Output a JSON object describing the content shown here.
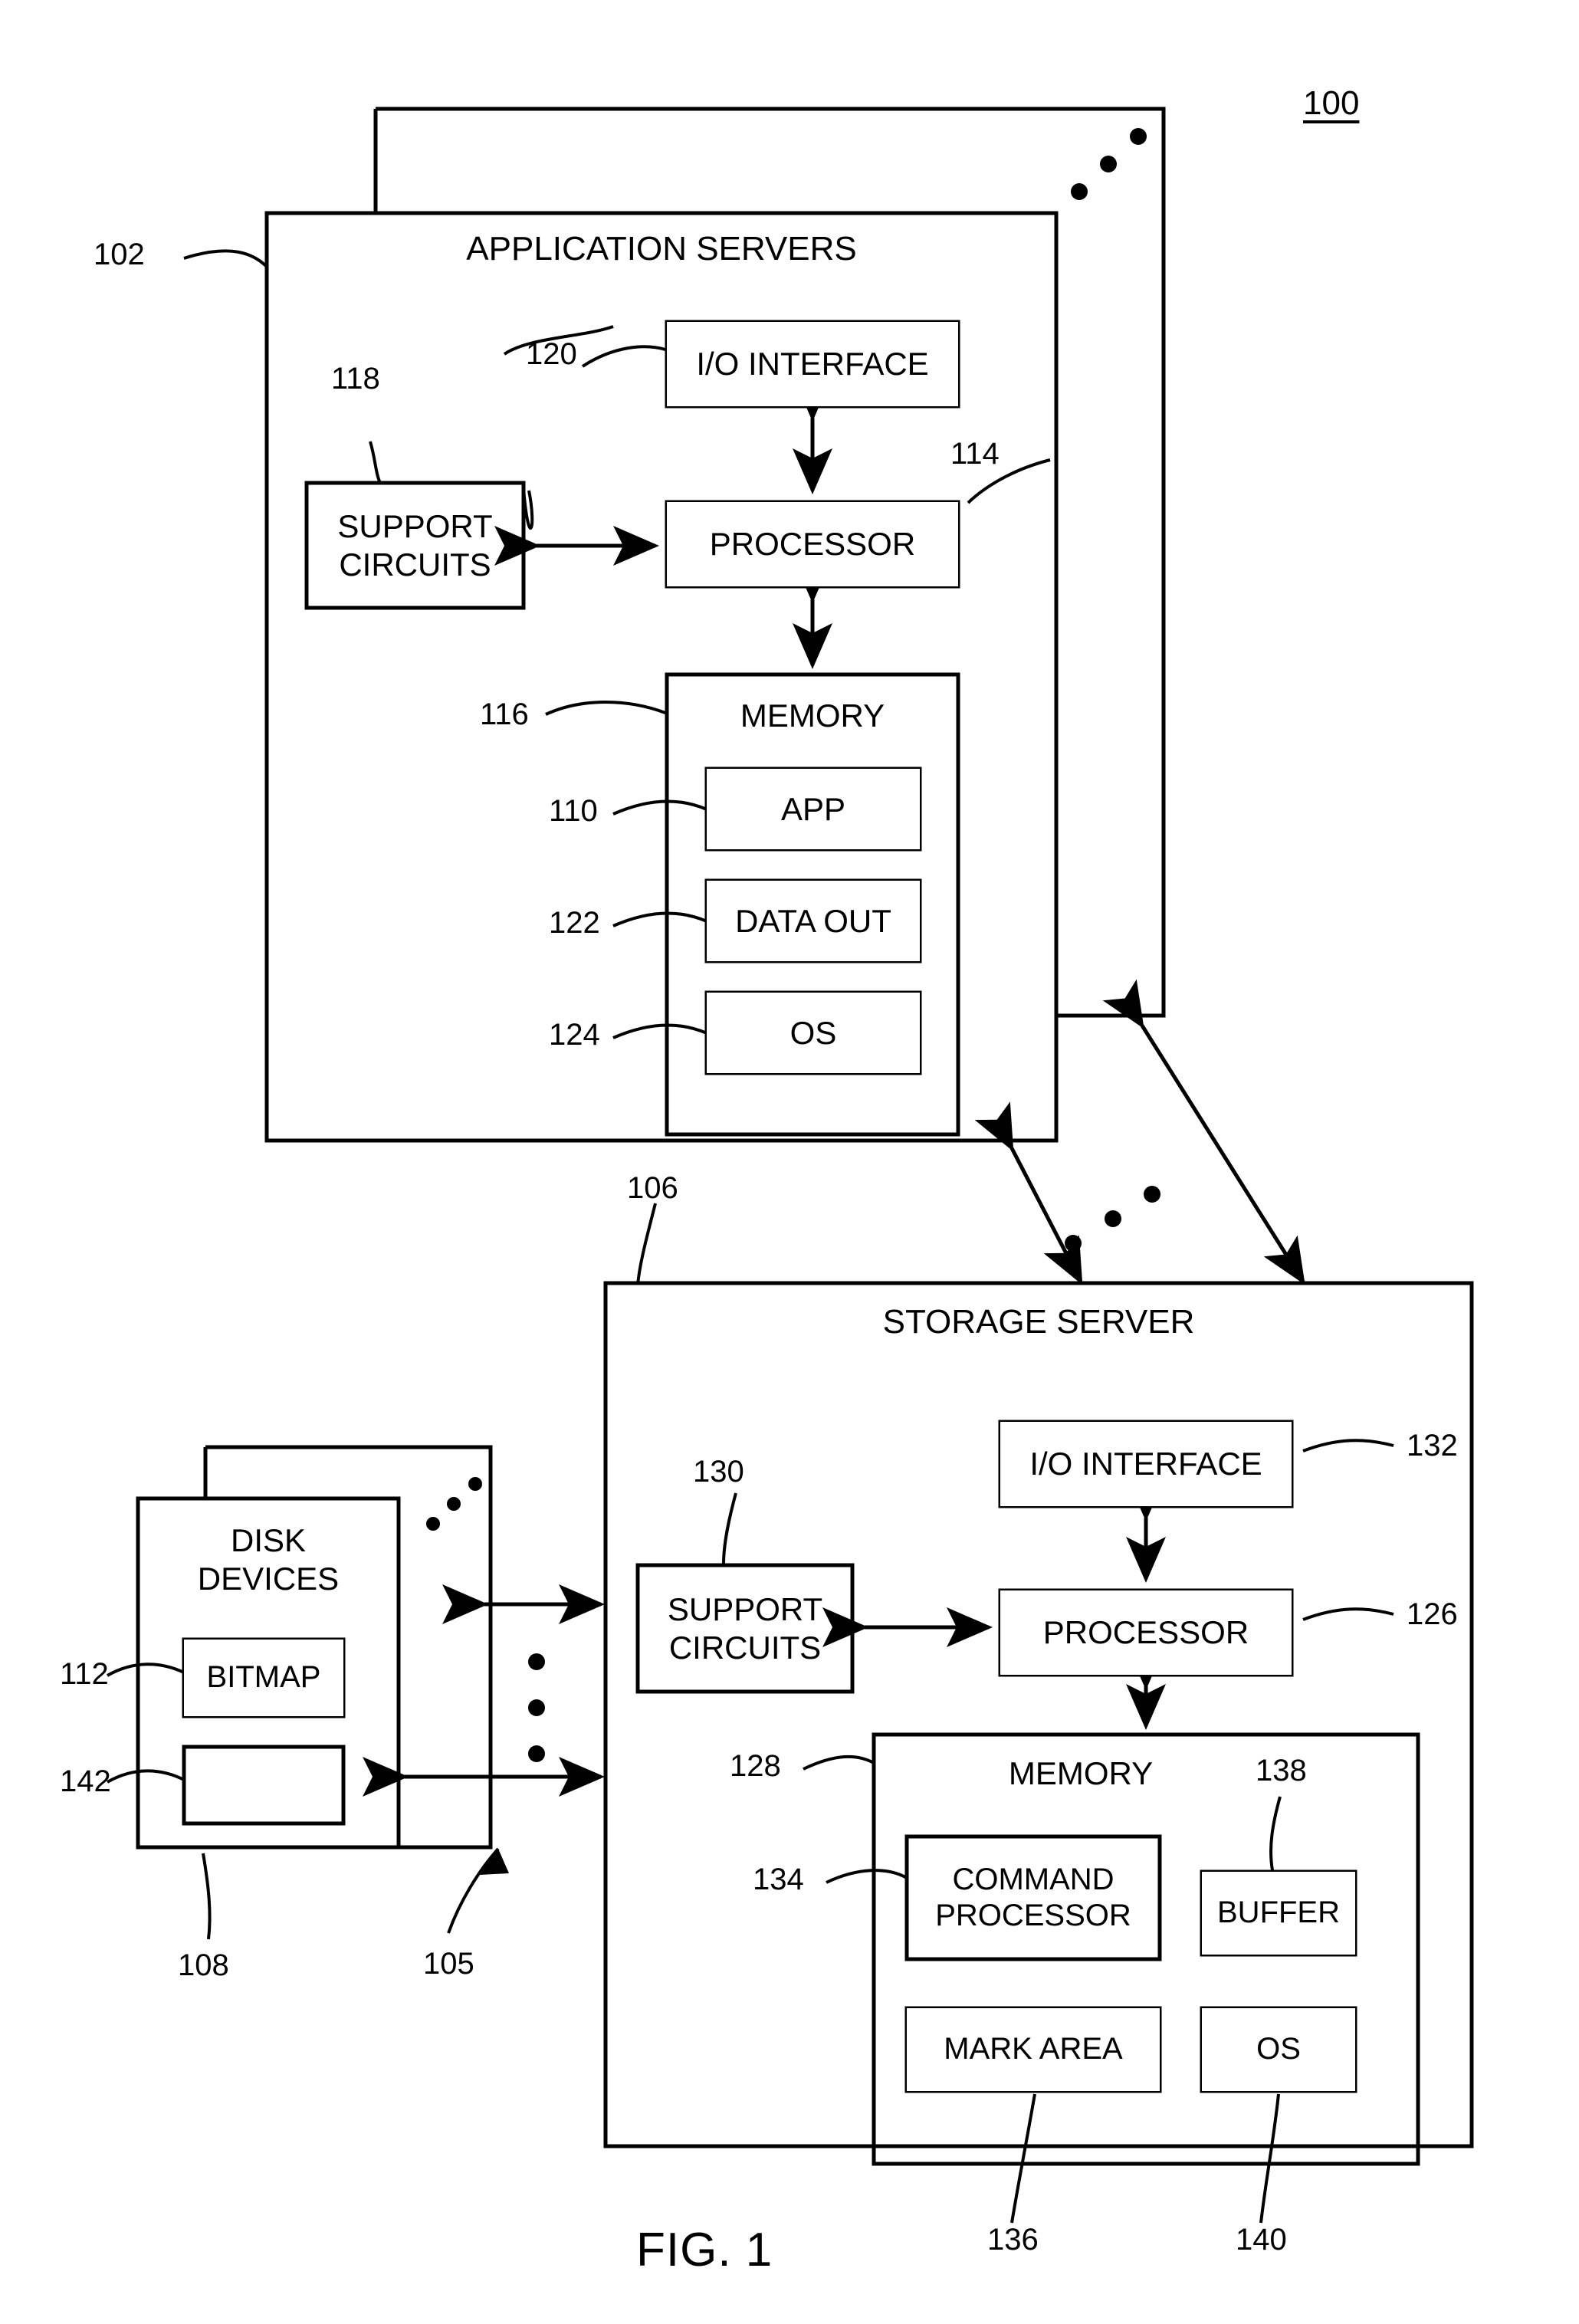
{
  "figure": {
    "caption": "FIG. 1",
    "system_ref": "100"
  },
  "application_servers": {
    "title": "APPLICATION SERVERS",
    "ref": "102",
    "stack_ellipsis": "three dots indicating additional application servers",
    "components": {
      "io_interface": {
        "label": "I/O INTERFACE",
        "ref": "120"
      },
      "processor": {
        "label": "PROCESSOR",
        "ref": "114"
      },
      "support_circuits": {
        "label": "SUPPORT\nCIRCUITS",
        "line1": "SUPPORT",
        "line2": "CIRCUITS",
        "ref": "118"
      },
      "memory": {
        "label": "MEMORY",
        "ref": "116"
      },
      "app": {
        "label": "APP",
        "ref": "110"
      },
      "data_out": {
        "label": "DATA  OUT",
        "ref": "122"
      },
      "os": {
        "label": "OS",
        "ref": "124"
      }
    }
  },
  "storage_server": {
    "title": "STORAGE SERVER",
    "ref": "106",
    "components": {
      "io_interface": {
        "label": "I/O INTERFACE",
        "ref": "132"
      },
      "processor": {
        "label": "PROCESSOR",
        "ref": "126"
      },
      "support_circuits": {
        "line1": "SUPPORT",
        "line2": "CIRCUITS",
        "ref": "130"
      },
      "memory": {
        "label": "MEMORY",
        "ref": "128"
      },
      "command_processor": {
        "line1": "COMMAND",
        "line2": "PROCESSOR",
        "ref": "134"
      },
      "buffer": {
        "label": "BUFFER",
        "ref": "138"
      },
      "mark_area": {
        "label": "MARK AREA",
        "ref": "136"
      },
      "os": {
        "label": "OS",
        "ref": "140"
      }
    }
  },
  "disk_devices": {
    "line1": "DISK",
    "line2": "DEVICES",
    "ref": "108",
    "bitmap": {
      "label": "BITMAP",
      "ref": "112"
    },
    "unlabeled_region": {
      "label": "",
      "ref": "142"
    },
    "stack_ellipsis": "three dots indicating additional disk devices"
  },
  "connections": {
    "disk_to_storage_ref": "105",
    "disk_to_storage_ellipsis": "three vertical dots indicating additional links",
    "servers_to_storage_ellipsis": "three dots indicating additional links"
  },
  "style": {
    "stroke": "#000000",
    "background": "#ffffff"
  }
}
